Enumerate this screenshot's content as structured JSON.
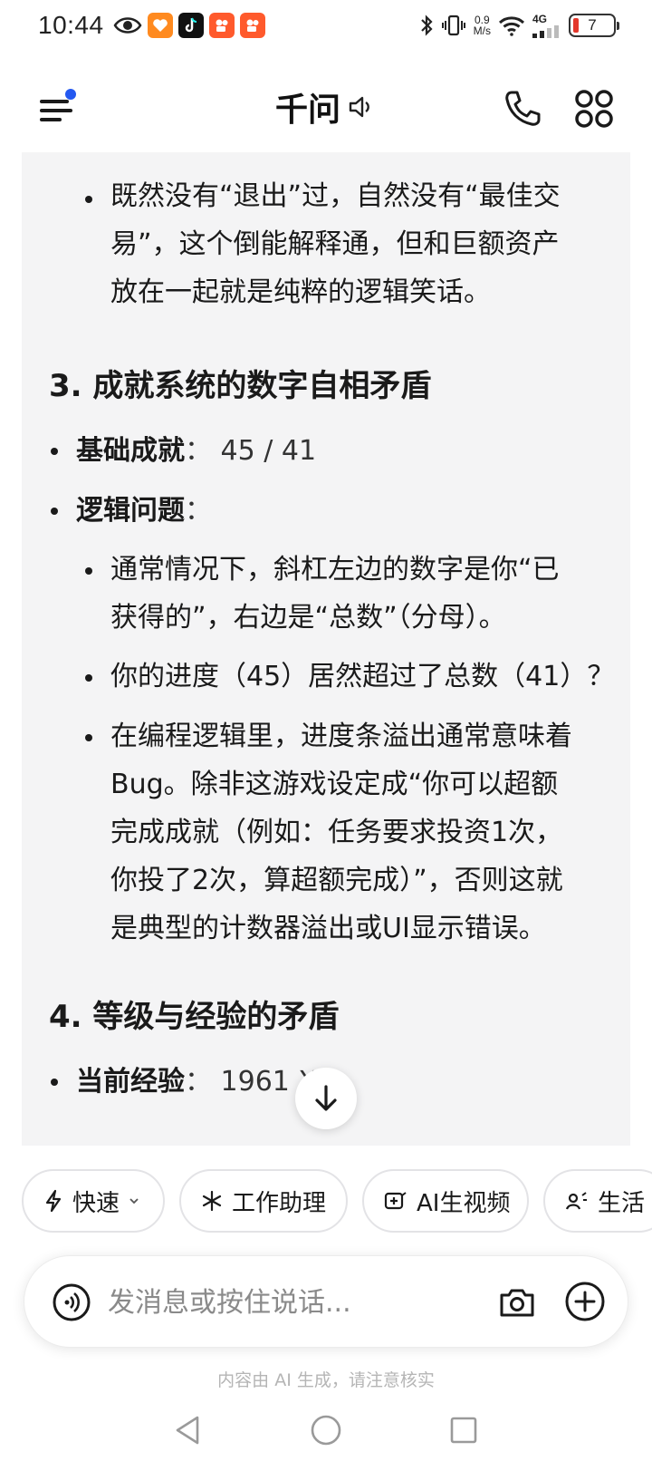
{
  "status_bar": {
    "time": "10:44",
    "net_speed_value": "0.9",
    "net_speed_unit": "M/s",
    "net_type": "4G",
    "battery": "7"
  },
  "header": {
    "title": "千问"
  },
  "message": {
    "blocks": [
      {
        "type": "sub_bullet",
        "lines": [
          "既然没有“退出”过，自然没有“最佳交",
          "易”，这个倒能解释通，但和巨额资产",
          "放在一起就是纯粹的逻辑笑话。"
        ]
      },
      {
        "type": "heading",
        "text": "3. 成就系统的数字自相矛盾"
      },
      {
        "type": "bullet_kv",
        "key": "基础成就",
        "value": "：  45 / 41"
      },
      {
        "type": "bullet_kv",
        "key": "逻辑问题",
        "value": "："
      },
      {
        "type": "sub_bullet",
        "lines": [
          "通常情况下，斜杠左边的数字是你“已",
          "获得的”，右边是“总数”（分母）。"
        ]
      },
      {
        "type": "sub_bullet",
        "lines": [
          "你的进度（45）居然超过了总数（41）？"
        ]
      },
      {
        "type": "sub_bullet",
        "lines": [
          "在编程逻辑里，进度条溢出通常意味着",
          "Bug。除非这游戏设定成“你可以超额",
          "完成成就（例如：任务要求投资1次，",
          "你投了2次，算超额完成）”，否则这就",
          "是典型的计数器溢出或UI显示错误。"
        ]
      },
      {
        "type": "heading",
        "text": "4. 等级与经验的矛盾"
      },
      {
        "type": "bullet_kv",
        "key": "当前经验",
        "value": "：  1961 XP"
      }
    ]
  },
  "chips": [
    {
      "label": "快速",
      "icon": "bolt-icon",
      "has_dropdown": true
    },
    {
      "label": "工作助理",
      "icon": "sparkle-icon"
    },
    {
      "label": "AI生视频",
      "icon": "video-plus-icon"
    },
    {
      "label": "生活",
      "icon": "life-icon"
    }
  ],
  "input": {
    "placeholder": "发消息或按住说话..."
  },
  "disclaimer": "内容由 AI 生成，请注意核实"
}
